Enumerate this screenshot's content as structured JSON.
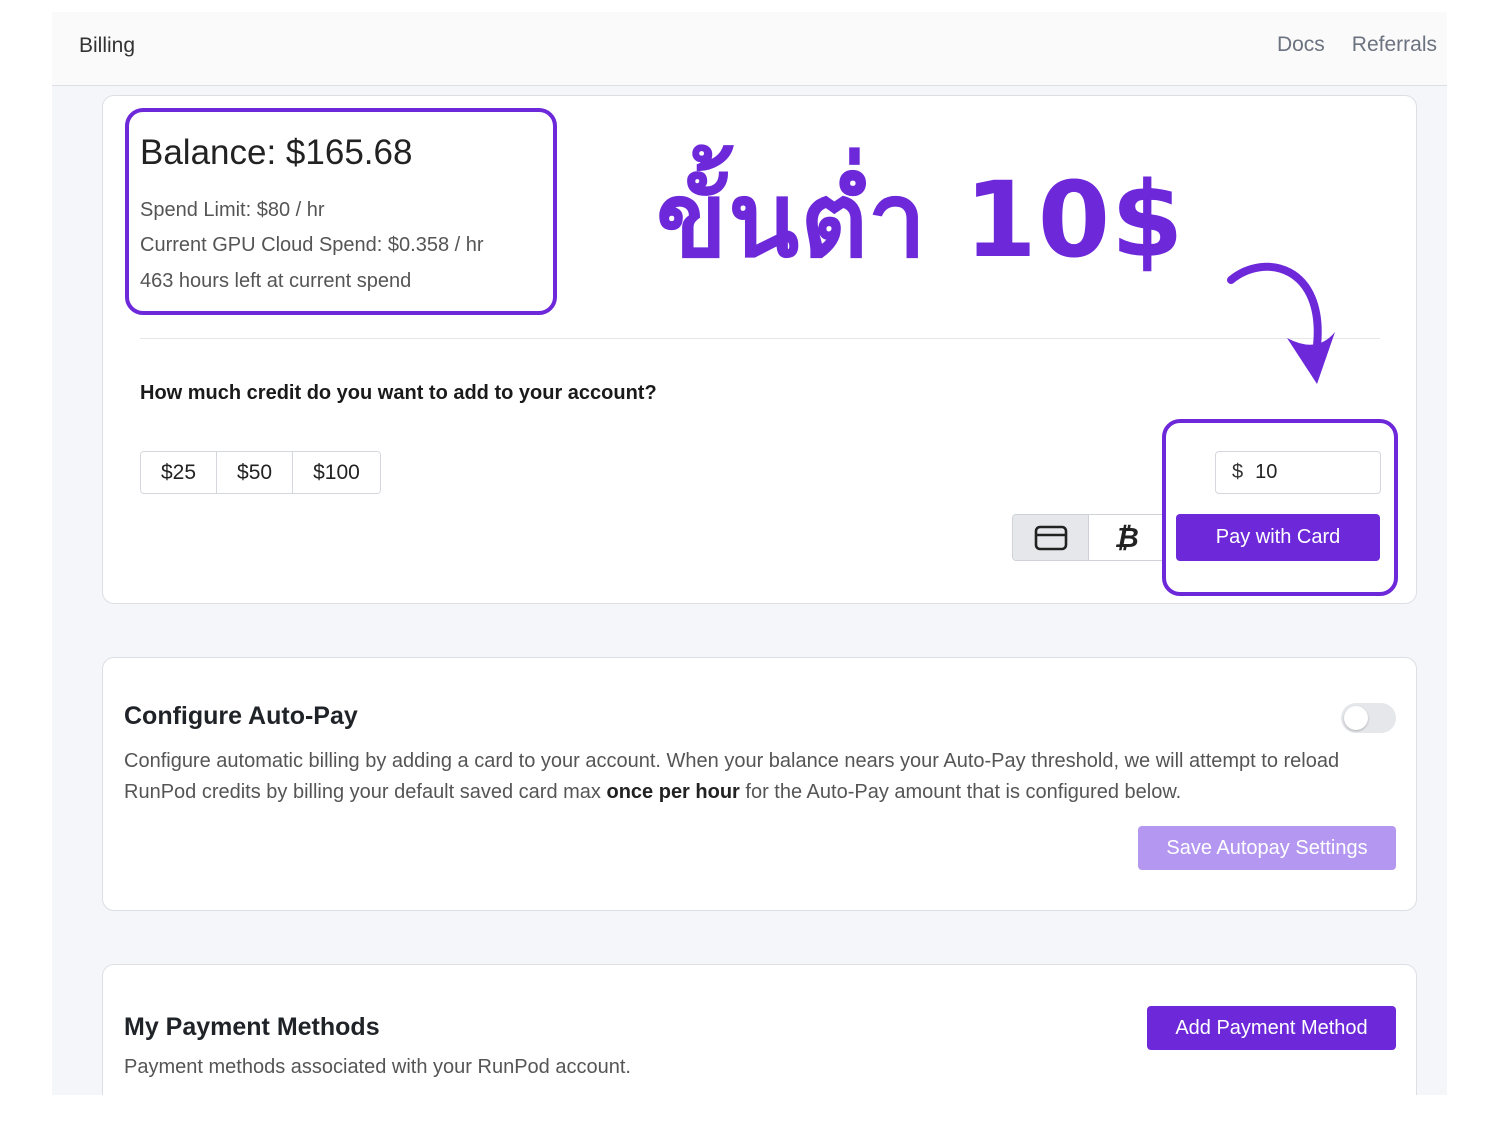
{
  "header": {
    "title": "Billing",
    "nav": [
      "Docs",
      "Referrals"
    ]
  },
  "balance": {
    "title": "Balance: $165.68",
    "spend_limit": "Spend Limit: $80 / hr",
    "current_spend": "Current GPU Cloud Spend: $0.358 / hr",
    "hours_left": "463 hours left at current spend"
  },
  "annotation": {
    "text": "ขั้นต่ำ 10$",
    "color": "#6d28d9"
  },
  "add_credit": {
    "question": "How much credit do you want to add to your account?",
    "presets": [
      "$25",
      "$50",
      "$100"
    ],
    "currency_symbol": "$",
    "amount_value": "10",
    "method_options": [
      "card-icon",
      "bitcoin-icon"
    ],
    "bitcoin_glyph": "₿",
    "pay_label": "Pay with Card"
  },
  "autopay": {
    "title": "Configure Auto-Pay",
    "desc_before": "Configure automatic billing by adding a card to your account. When your balance nears your Auto-Pay threshold, we will attempt to reload RunPod credits by billing your default saved card max ",
    "desc_bold": "once per hour",
    "desc_after": " for the Auto-Pay amount that is configured below.",
    "enabled": false,
    "save_label": "Save Autopay Settings"
  },
  "payment_methods": {
    "title": "My Payment Methods",
    "desc": "Payment methods associated with your RunPod account.",
    "add_label": "Add Payment Method"
  },
  "colors": {
    "accent": "#6d28d9",
    "accent_disabled": "#b497f0"
  }
}
